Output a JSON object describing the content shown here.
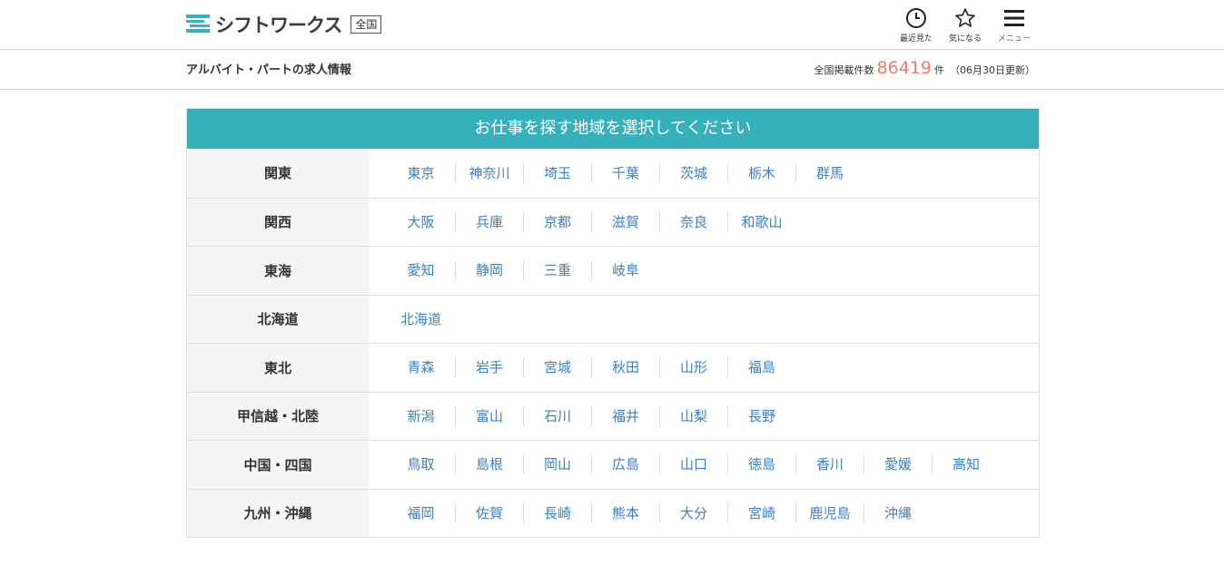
{
  "header": {
    "logo_text": "シフトワークス",
    "area_badge": "全国",
    "brand_color": "#36b0ba",
    "nav": [
      {
        "label": "最近見た",
        "icon": "clock-icon"
      },
      {
        "label": "気になる",
        "icon": "star-icon"
      },
      {
        "label": "メニュー",
        "icon": "hamburger-icon"
      }
    ]
  },
  "subheader": {
    "tagline": "アルバイト・パートの求人情報",
    "count_prefix": "全国掲載件数",
    "count_value": "86419",
    "count_suffix": "件",
    "updated": "（06月30日更新）"
  },
  "panel": {
    "title": "お仕事を探す地域を選択してください",
    "regions": [
      {
        "name": "関東",
        "prefectures": [
          "東京",
          "神奈川",
          "埼玉",
          "千葉",
          "茨城",
          "栃木",
          "群馬"
        ]
      },
      {
        "name": "関西",
        "prefectures": [
          "大阪",
          "兵庫",
          "京都",
          "滋賀",
          "奈良",
          "和歌山"
        ]
      },
      {
        "name": "東海",
        "prefectures": [
          "愛知",
          "静岡",
          "三重",
          "岐阜"
        ]
      },
      {
        "name": "北海道",
        "prefectures": [
          "北海道"
        ]
      },
      {
        "name": "東北",
        "prefectures": [
          "青森",
          "岩手",
          "宮城",
          "秋田",
          "山形",
          "福島"
        ]
      },
      {
        "name": "甲信越・北陸",
        "prefectures": [
          "新潟",
          "富山",
          "石川",
          "福井",
          "山梨",
          "長野"
        ]
      },
      {
        "name": "中国・四国",
        "prefectures": [
          "鳥取",
          "島根",
          "岡山",
          "広島",
          "山口",
          "徳島",
          "香川",
          "愛媛",
          "高知"
        ]
      },
      {
        "name": "九州・沖縄",
        "prefectures": [
          "福岡",
          "佐賀",
          "長崎",
          "熊本",
          "大分",
          "宮崎",
          "鹿児島",
          "沖縄"
        ]
      }
    ]
  }
}
